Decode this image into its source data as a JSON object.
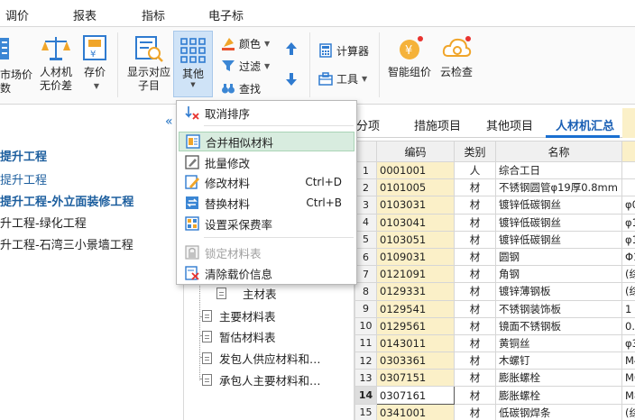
{
  "menubar": {
    "items": [
      "调价",
      "报表",
      "指标",
      "电子标"
    ]
  },
  "ribbon": {
    "market_price": "市场价\n数",
    "no_price": "人材机\n无价差",
    "save_price": "存价",
    "show_sub": "显示对应\n子目",
    "other": "其他",
    "color": "颜色",
    "filter": "过滤",
    "find": "查找",
    "calculator": "计算器",
    "tools": "工具",
    "smart_price": "智能组价",
    "cloud_check": "云检查"
  },
  "colors": {
    "accent": "#1a6fd0",
    "hover": "#d8ecdf",
    "highlight_col": "#fbf0c8"
  },
  "left_tree": [
    "提升工程",
    "提升工程",
    "提升工程-外立面装修工程",
    "升工程-绿化工程",
    "升工程-石湾三小景墙工程"
  ],
  "mid_tree": [
    "主材表",
    "主要材料表",
    "暂估材料表",
    "发包人供应材料和…",
    "承包人主要材料和…"
  ],
  "menu": {
    "items": [
      {
        "label": "取消排序",
        "shortcut": "",
        "icon": "sort-cancel-icon"
      },
      {
        "label": "合并相似材料",
        "shortcut": "",
        "icon": "merge-icon"
      },
      {
        "label": "批量修改",
        "shortcut": "",
        "icon": "batch-edit-icon"
      },
      {
        "label": "修改材料",
        "shortcut": "Ctrl+D",
        "icon": "edit-material-icon"
      },
      {
        "label": "替换材料",
        "shortcut": "Ctrl+B",
        "icon": "replace-icon"
      },
      {
        "label": "设置采保费率",
        "shortcut": "",
        "icon": "rate-icon"
      },
      {
        "label": "锁定材料表",
        "shortcut": "",
        "icon": "lock-icon"
      },
      {
        "label": "清除载价信息",
        "shortcut": "",
        "icon": "clear-icon"
      }
    ]
  },
  "tabs": [
    "分项",
    "措施项目",
    "其他项目",
    "人材机汇总"
  ],
  "grid": {
    "headers": [
      "编码",
      "类别",
      "名称"
    ],
    "rows": [
      {
        "n": "1",
        "code": "0001001",
        "cat": "人",
        "name": "综合工日",
        "extra": ""
      },
      {
        "n": "2",
        "code": "0101005",
        "cat": "材",
        "name": "不锈钢圆管φ19厚0.8mm",
        "extra": ""
      },
      {
        "n": "3",
        "code": "0103031",
        "cat": "材",
        "name": "镀锌低碳钢丝",
        "extra": "φ0"
      },
      {
        "n": "4",
        "code": "0103041",
        "cat": "材",
        "name": "镀锌低碳钢丝",
        "extra": "φ1"
      },
      {
        "n": "5",
        "code": "0103051",
        "cat": "材",
        "name": "镀锌低碳钢丝",
        "extra": "φ1"
      },
      {
        "n": "6",
        "code": "0109031",
        "cat": "材",
        "name": "圆钢",
        "extra": "Φ1"
      },
      {
        "n": "7",
        "code": "0121091",
        "cat": "材",
        "name": "角钢",
        "extra": "(综"
      },
      {
        "n": "8",
        "code": "0129331",
        "cat": "材",
        "name": "镀锌薄钢板",
        "extra": "(综"
      },
      {
        "n": "9",
        "code": "0129541",
        "cat": "材",
        "name": "不锈钢装饰板",
        "extra": "1"
      },
      {
        "n": "10",
        "code": "0129561",
        "cat": "材",
        "name": "镜面不锈钢板",
        "extra": "0."
      },
      {
        "n": "11",
        "code": "0143011",
        "cat": "材",
        "name": "黄铜丝",
        "extra": "φ3"
      },
      {
        "n": "12",
        "code": "0303361",
        "cat": "材",
        "name": "木螺钉",
        "extra": "M4"
      },
      {
        "n": "13",
        "code": "0307151",
        "cat": "材",
        "name": "膨胀螺栓",
        "extra": "M6"
      },
      {
        "n": "14",
        "code": "0307161",
        "cat": "材",
        "name": "膨胀螺栓",
        "extra": "M8"
      },
      {
        "n": "15",
        "code": "0341001",
        "cat": "材",
        "name": "低碳钢焊条",
        "extra": "(综"
      }
    ]
  }
}
